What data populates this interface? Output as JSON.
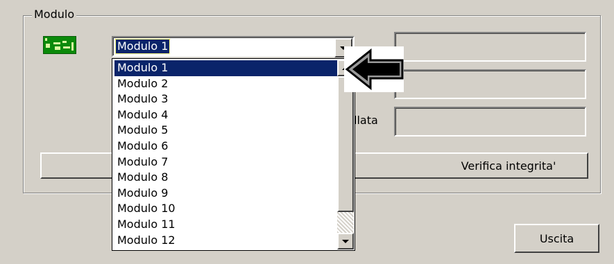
{
  "group": {
    "label": "Modulo"
  },
  "combo": {
    "selected": "Modulo 1"
  },
  "dropdown": {
    "items": [
      "Modulo 1",
      "Modulo 2",
      "Modulo 3",
      "Modulo 4",
      "Modulo 5",
      "Modulo 6",
      "Modulo 7",
      "Modulo 8",
      "Modulo 9",
      "Modulo 10",
      "Modulo 11",
      "Modulo 12"
    ],
    "selected_index": 0
  },
  "partial_label": "llata",
  "buttons": {
    "verify": "Verifica integrita'",
    "exit": "Uscita"
  },
  "icons": {
    "module": "circuit-board-icon",
    "pointer": "arrow-left-icon"
  },
  "colors": {
    "face": "#d4d0c8",
    "highlight": "#0a246a",
    "icon_green": "#0b8a0b"
  }
}
